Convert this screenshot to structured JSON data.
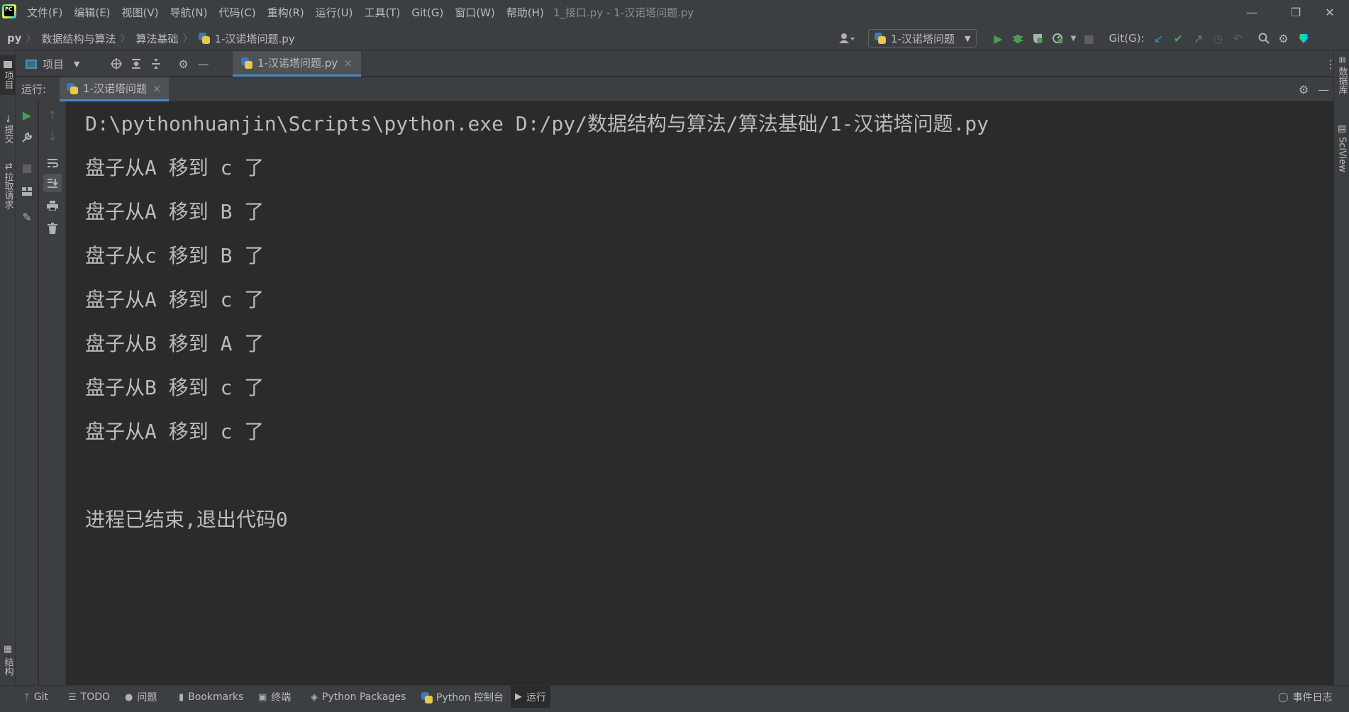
{
  "colors": {
    "window_bg": "#3c3f41",
    "console_bg": "#2b2b2b",
    "text": "#bbbbbb",
    "accent": "#4a88c7",
    "run_green": "#499c54",
    "git_blue": "#3592c4"
  },
  "titlebar": {
    "menu": [
      "文件(F)",
      "编辑(E)",
      "视图(V)",
      "导航(N)",
      "代码(C)",
      "重构(R)",
      "运行(U)",
      "工具(T)",
      "Git(G)",
      "窗口(W)",
      "帮助(H)"
    ],
    "window_title": "1_接口.py - 1-汉诺塔问题.py",
    "controls": {
      "minimize": "—",
      "restore": "❐",
      "close": "✕"
    }
  },
  "navbar": {
    "breadcrumbs": [
      "py",
      "数据结构与算法",
      "算法基础",
      "1-汉诺塔问题.py"
    ],
    "run_config": "1-汉诺塔问题",
    "git_label": "Git(G):"
  },
  "left_stripe": {
    "project": "项目",
    "commit": "提交",
    "pull_requests": "拉取请求",
    "structure": "结构"
  },
  "right_stripe": {
    "database": "数据库",
    "sciview": "SciView"
  },
  "tabs": {
    "project_tool": "项目",
    "editor_tab": "1-汉诺塔问题.py",
    "close": "×"
  },
  "run_panel": {
    "label": "运行:",
    "tab": "1-汉诺塔问题",
    "close": "×"
  },
  "console": {
    "command": "D:\\pythonhuanjin\\Scripts\\python.exe D:/py/数据结构与算法/算法基础/1-汉诺塔问题.py",
    "lines": [
      "盘子从A 移到 c 了",
      "盘子从A 移到 B 了",
      "盘子从c 移到 B 了",
      "盘子从A 移到 c 了",
      "盘子从B 移到 A 了",
      "盘子从B 移到 c 了",
      "盘子从A 移到 c 了"
    ],
    "exit_message": "进程已结束,退出代码0"
  },
  "bottombar": {
    "items": [
      "Git",
      "TODO",
      "问题",
      "Bookmarks",
      "终端",
      "Python Packages",
      "Python 控制台",
      "运行"
    ],
    "event_log": "事件日志"
  },
  "icons": [
    "app-logo-icon",
    "search-icon",
    "settings-icon",
    "run-icon",
    "debug-icon",
    "coverage-icon",
    "profile-icon",
    "stop-icon",
    "git-update-icon",
    "git-commit-icon",
    "git-push-icon",
    "history-icon",
    "rollback-icon",
    "user-icon"
  ]
}
